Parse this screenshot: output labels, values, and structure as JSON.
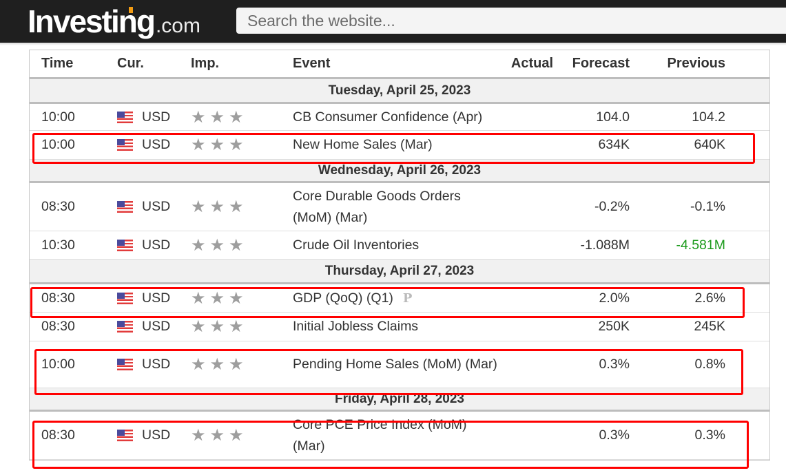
{
  "header": {
    "logo_main": "Investing",
    "logo_suffix": ".com",
    "search_placeholder": "Search the website..."
  },
  "table": {
    "columns": {
      "time": "Time",
      "currency": "Cur.",
      "importance": "Imp.",
      "event": "Event",
      "actual": "Actual",
      "forecast": "Forecast",
      "previous": "Previous"
    },
    "days": [
      {
        "date": "Tuesday, April 25, 2023",
        "events": [
          {
            "time": "10:00",
            "currency": "USD",
            "flag": "us-flag-icon",
            "importance": 3,
            "event": "CB Consumer Confidence (Apr)",
            "actual": "",
            "forecast": "104.0",
            "previous": "104.2",
            "highlighted": false
          },
          {
            "time": "10:00",
            "currency": "USD",
            "flag": "us-flag-icon",
            "importance": 3,
            "event": "New Home Sales (Mar)",
            "actual": "",
            "forecast": "634K",
            "previous": "640K",
            "highlighted": true
          }
        ]
      },
      {
        "date": "Wednesday, April 26, 2023",
        "events": [
          {
            "time": "08:30",
            "currency": "USD",
            "flag": "us-flag-icon",
            "importance": 3,
            "event": "Core Durable Goods Orders (MoM) (Mar)",
            "actual": "",
            "forecast": "-0.2%",
            "previous": "-0.1%",
            "highlighted": false
          },
          {
            "time": "10:30",
            "currency": "USD",
            "flag": "us-flag-icon",
            "importance": 3,
            "event": "Crude Oil Inventories",
            "actual": "",
            "forecast": "-1.088M",
            "previous": "-4.581M",
            "previous_color": "#1a9a1a",
            "highlighted": false
          }
        ]
      },
      {
        "date": "Thursday, April 27, 2023",
        "events": [
          {
            "time": "08:30",
            "currency": "USD",
            "flag": "us-flag-icon",
            "importance": 3,
            "event": "GDP (QoQ) (Q1)",
            "preliminary_mark": "P",
            "actual": "",
            "forecast": "2.0%",
            "previous": "2.6%",
            "highlighted": true
          },
          {
            "time": "08:30",
            "currency": "USD",
            "flag": "us-flag-icon",
            "importance": 3,
            "event": "Initial Jobless Claims",
            "actual": "",
            "forecast": "250K",
            "previous": "245K",
            "highlighted": false
          },
          {
            "time": "10:00",
            "currency": "USD",
            "flag": "us-flag-icon",
            "importance": 3,
            "event": "Pending Home Sales (MoM) (Mar)",
            "actual": "",
            "forecast": "0.3%",
            "previous": "0.8%",
            "highlighted": true
          }
        ]
      },
      {
        "date": "Friday, April 28, 2023",
        "events": [
          {
            "time": "08:30",
            "currency": "USD",
            "flag": "us-flag-icon",
            "importance": 3,
            "event": "Core PCE Price Index (MoM) (Mar)",
            "actual": "",
            "forecast": "0.3%",
            "previous": "0.3%",
            "highlighted": true
          }
        ]
      }
    ]
  },
  "colors": {
    "highlight_border": "#ff0000",
    "positive_value": "#1a9a1a",
    "topbar": "#1f1f1f",
    "logo_accent": "#f39c12"
  }
}
